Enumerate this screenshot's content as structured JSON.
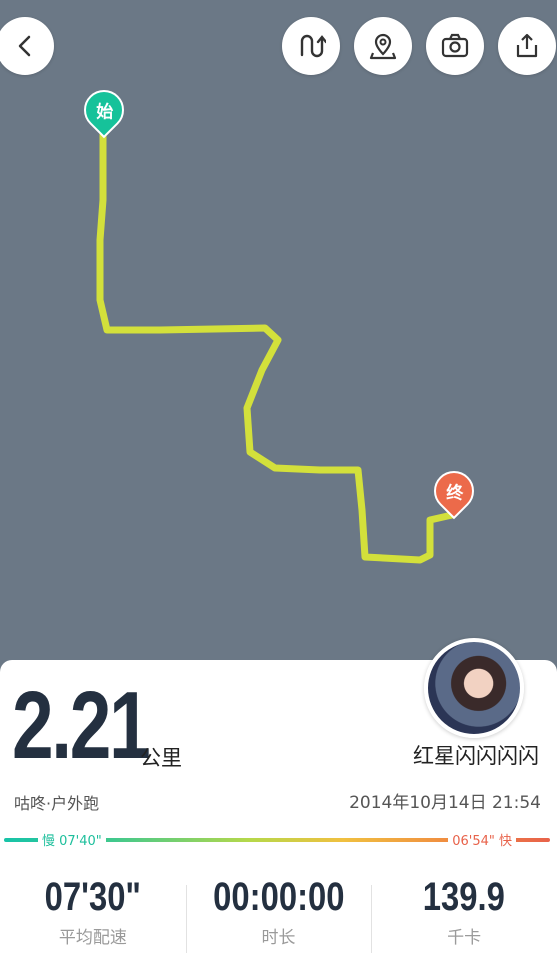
{
  "toolbar": {
    "back_icon": "chevron-left-icon",
    "actions": [
      "route-toggle-icon",
      "location-pin-icon",
      "camera-icon",
      "share-icon"
    ]
  },
  "map": {
    "start_label": "始",
    "end_label": "终",
    "route_color": "#d3e03b",
    "start_color": "#16c29a",
    "end_color": "#ec6a4a"
  },
  "summary": {
    "distance": "2.21",
    "distance_unit": "公里",
    "username": "红星闪闪闪闪",
    "sport": "咕咚·户外跑",
    "datetime": "2014年10月14日 21:54",
    "pace_slow": "慢 07'40\"",
    "pace_fast": "06'54\" 快"
  },
  "stats": {
    "pace_value": "07'30\"",
    "pace_label": "平均配速",
    "duration_value": "00:00:00",
    "duration_label": "时长",
    "calories_value": "139.9",
    "calories_label": "千卡"
  }
}
